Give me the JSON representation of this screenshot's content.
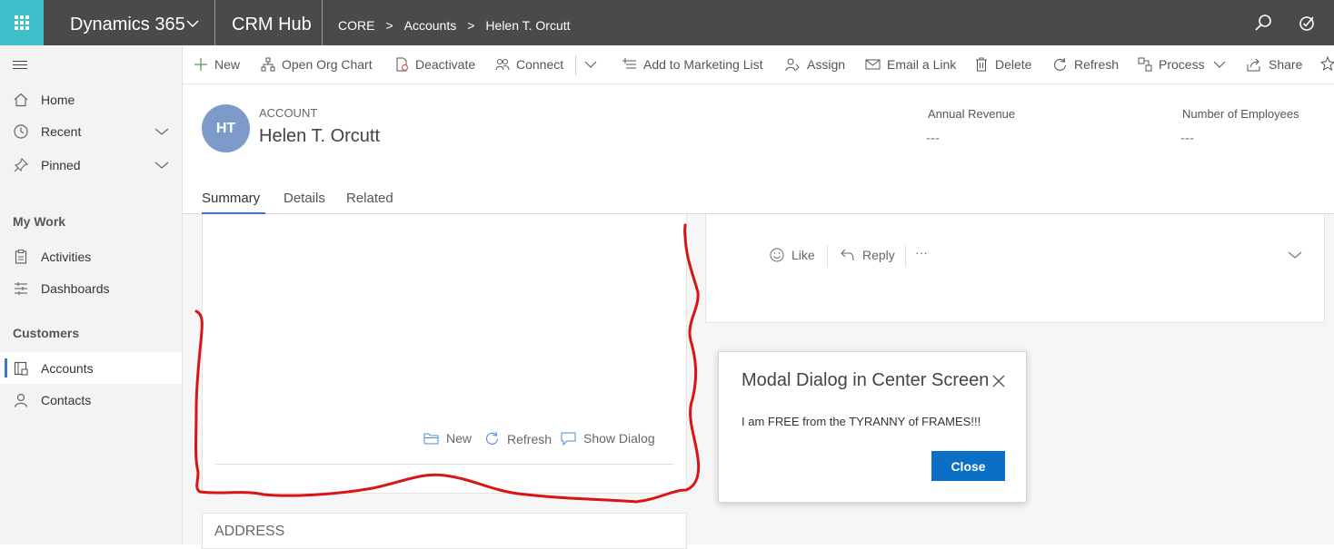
{
  "topbar": {
    "brand": "Dynamics 365",
    "app": "CRM Hub",
    "breadcrumb": [
      "CORE",
      "Accounts",
      "Helen T. Orcutt"
    ],
    "icons": [
      "waffle-icon",
      "search-icon",
      "task-icon"
    ],
    "colors": {
      "bar": "#4a4a4a",
      "waffle": "#3fbfca"
    }
  },
  "sidebar": {
    "items": [
      {
        "label": "Home",
        "icon": "home-icon"
      },
      {
        "label": "Recent",
        "icon": "clock-icon"
      },
      {
        "label": "Pinned",
        "icon": "pin-icon"
      }
    ],
    "my_work": {
      "heading": "My Work",
      "items": [
        {
          "label": "Activities",
          "icon": "clipboard-icon"
        },
        {
          "label": "Dashboards",
          "icon": "dashboard-icon"
        }
      ]
    },
    "customers": {
      "heading": "Customers",
      "items": [
        {
          "label": "Accounts",
          "icon": "account-icon",
          "selected": true
        },
        {
          "label": "Contacts",
          "icon": "person-icon"
        }
      ]
    }
  },
  "commands": {
    "new": "New",
    "org_chart": "Open Org Chart",
    "deactivate": "Deactivate",
    "connect": "Connect",
    "marketing": "Add to Marketing List",
    "assign": "Assign",
    "email_link": "Email a Link",
    "delete": "Delete",
    "refresh": "Refresh",
    "process": "Process",
    "share": "Share"
  },
  "header": {
    "initials": "HT",
    "entity_type": "ACCOUNT",
    "name": "Helen T. Orcutt",
    "fields": [
      {
        "label": "Annual Revenue",
        "value": "---"
      },
      {
        "label": "Number of Employees",
        "value": "---"
      }
    ]
  },
  "tabs": [
    "Summary",
    "Details",
    "Related"
  ],
  "subgrid": {
    "new": "New",
    "refresh": "Refresh",
    "show_dialog": "Show Dialog"
  },
  "social": {
    "like": "Like",
    "reply": "Reply",
    "more": "···"
  },
  "address": {
    "title": "ADDRESS"
  },
  "modal": {
    "title": "Modal Dialog in Center Screen",
    "message": "I am FREE from the TYRANNY of FRAMES!!!",
    "button": "Close",
    "button_color": "#0b6fc6"
  },
  "annotation_color": "#d91414"
}
